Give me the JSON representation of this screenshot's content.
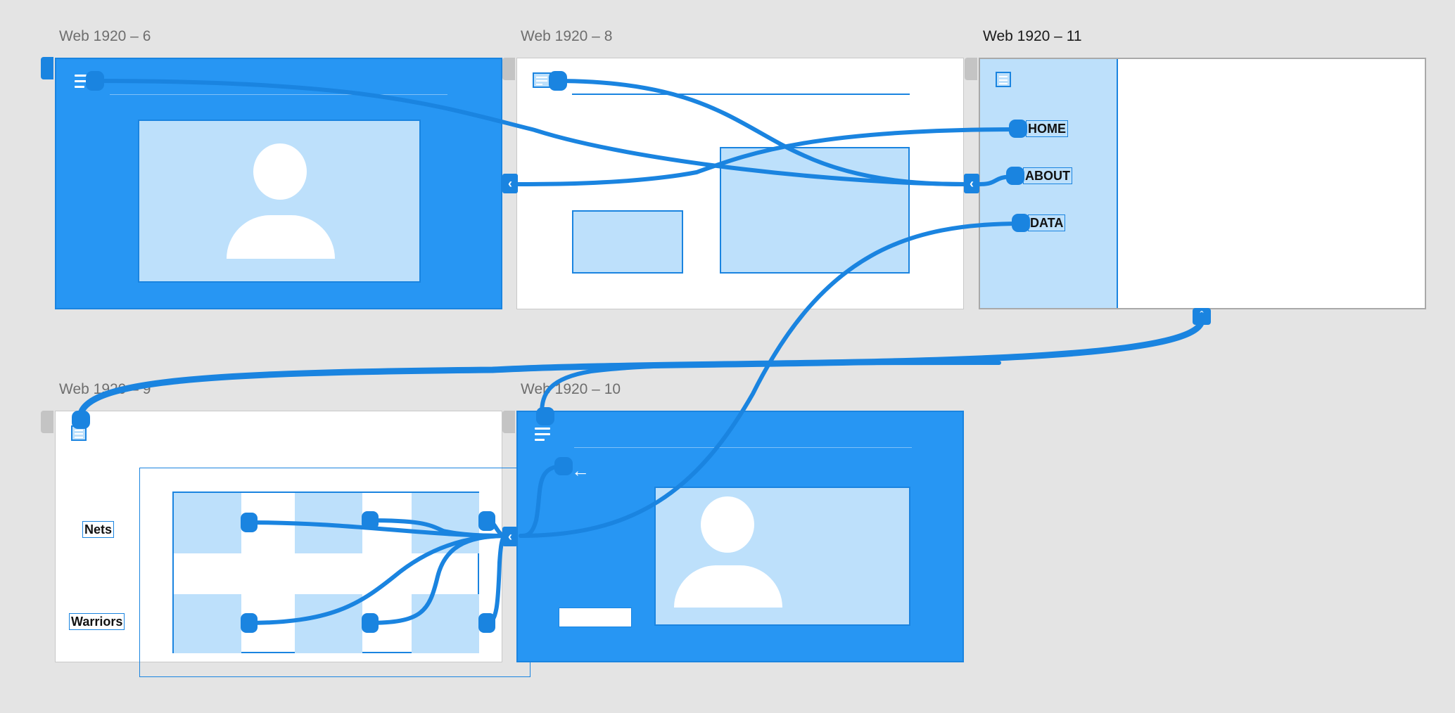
{
  "artboards": {
    "ab6": {
      "title": "Web 1920 – 6"
    },
    "ab8": {
      "title": "Web 1920 – 8"
    },
    "ab11": {
      "title": "Web 1920 – 11",
      "nav": [
        "HOME",
        "ABOUT",
        "DATA"
      ]
    },
    "ab9": {
      "title": "Web 1920 – 9",
      "teams": [
        "Nets",
        "Warriors"
      ]
    },
    "ab10": {
      "title": "Web 1920 – 10"
    }
  },
  "icons": {
    "menu": "hamburger-icon",
    "back": "chevron-left-icon",
    "up": "chevron-up-icon",
    "arrow_left": "arrow-left-icon",
    "avatar": "person-placeholder-icon"
  },
  "colors": {
    "canvas": "#e4e4e4",
    "accent": "#2796f3",
    "wire": "#1a84e0",
    "light": "#bde0fb"
  }
}
